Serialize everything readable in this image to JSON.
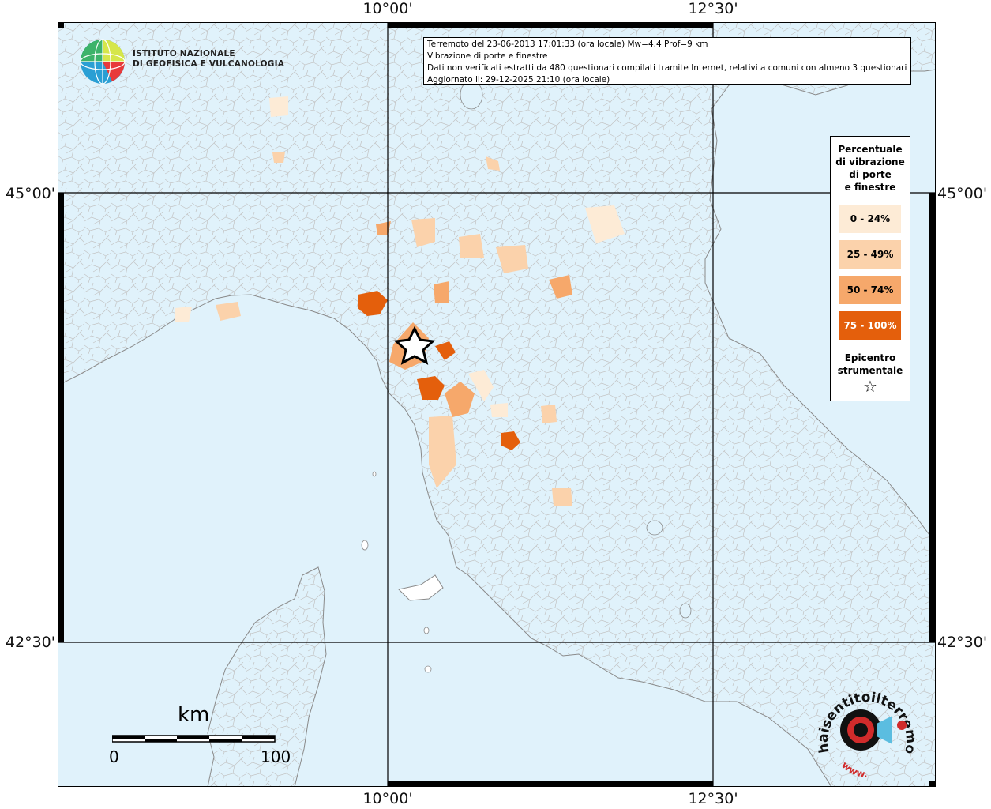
{
  "map": {
    "graticule": {
      "lon_labels": [
        "10°00'",
        "12°30'"
      ],
      "lat_labels": [
        "45°00'",
        "42°30'"
      ]
    },
    "colors": {
      "sea": "#e0f2fb",
      "land": "#ffffff",
      "borders": "#b9b9b9",
      "frame": "#000000"
    },
    "epicenter_symbol": "star-icon"
  },
  "info_box": {
    "line1": "Terremoto del 23-06-2013 17:01:33 (ora locale) Mw=4.4 Prof=9 km",
    "line2": "Vibrazione di porte e finestre",
    "line3": "Dati non verificati estratti da 480 questionari compilati tramite Internet, relativi a comuni con almeno 3 questionari.",
    "line4": "Aggiornato il: 29-12-2025 21:10 (ora locale)"
  },
  "legend": {
    "title_lines": [
      "Percentuale",
      "di vibrazione",
      "di porte",
      "e finestre"
    ],
    "classes": [
      {
        "label": "0 - 24%",
        "color": "#fdebd6",
        "text_color": "#000000"
      },
      {
        "label": "25 - 49%",
        "color": "#fbd2ab",
        "text_color": "#000000"
      },
      {
        "label": "50 - 74%",
        "color": "#f6a86b",
        "text_color": "#000000"
      },
      {
        "label": "75 - 100%",
        "color": "#e45f0c",
        "text_color": "#ffffff"
      }
    ],
    "epicenter_lines": [
      "Epicentro",
      "strumentale"
    ],
    "epicenter_icon": "☆"
  },
  "ingv": {
    "line1": "ISTITUTO NAZIONALE",
    "line2": "DI GEOFISICA E VULCANOLOGIA"
  },
  "scale_bar": {
    "unit": "km",
    "min": "0",
    "max": "100"
  },
  "hst_logo": {
    "text_outer": "haisentitoilterremoto.it",
    "text_inner": "www."
  }
}
